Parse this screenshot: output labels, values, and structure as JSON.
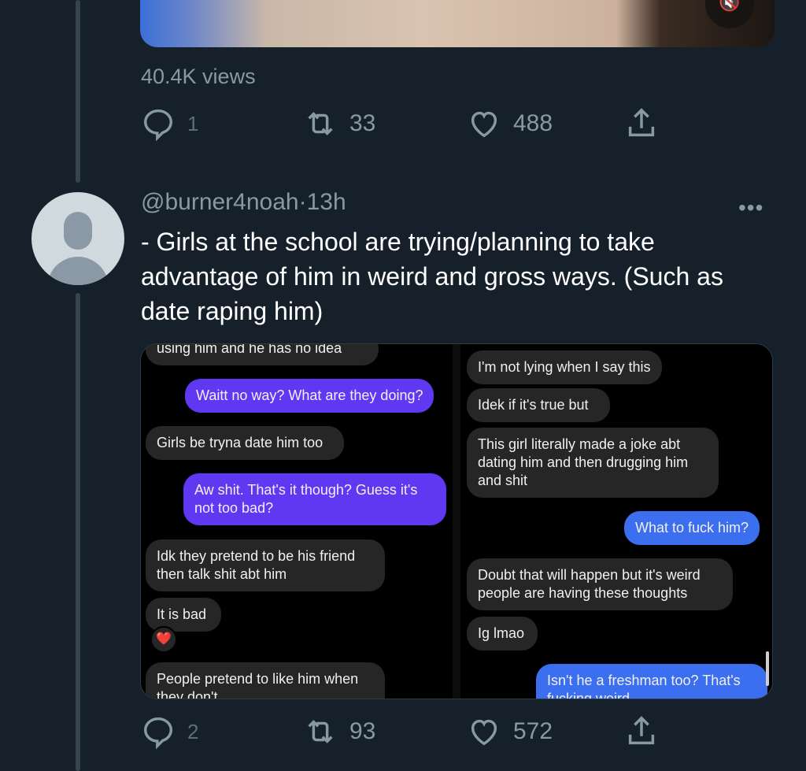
{
  "prev_tweet": {
    "views": "40.4K views",
    "replies": "1",
    "retweets": "33",
    "likes": "488"
  },
  "tweet": {
    "handle": "@burner4noah",
    "separator": "·",
    "time": "13h",
    "more": "•••",
    "text": "- Girls at the school are trying/planning to take advantage of him in weird and gross ways. (Such as date raping him)",
    "replies": "2",
    "retweets": "93",
    "likes": "572"
  },
  "media": {
    "left": {
      "messages": [
        {
          "from": "them",
          "text": "using him and he has no idea"
        },
        {
          "from": "me",
          "text": "Waitt no way? What are they doing?"
        },
        {
          "from": "them",
          "text": "Girls be tryna date him too"
        },
        {
          "from": "me",
          "text": "Aw shit. That's it though? Guess it's\nnot too bad?"
        },
        {
          "from": "them",
          "text": "Idk they pretend to be his friend\nthen talk shit abt him"
        },
        {
          "from": "them",
          "text": "It is bad"
        },
        {
          "from": "them",
          "text": "People pretend to like him when\nthey don't"
        }
      ],
      "reaction": "❤️"
    },
    "right": {
      "messages": [
        {
          "from": "them",
          "text": "I'm not lying when I say this"
        },
        {
          "from": "them",
          "text": "Idek if it's true but"
        },
        {
          "from": "them",
          "text": "This girl literally made a joke abt\ndating him and then drugging him\nand shit"
        },
        {
          "from": "me",
          "text": "What to fuck him?"
        },
        {
          "from": "them",
          "text": "Doubt that will happen but it's weird\npeople are having these thoughts"
        },
        {
          "from": "them",
          "text": "Ig lmao"
        },
        {
          "from": "me",
          "text": "Isn't he a freshman too? That's\nfucking weird"
        }
      ]
    }
  },
  "colors": {
    "background": "#15202b",
    "secondary_text": "#8899a6",
    "incoming_bubble": "#262626",
    "outgoing_bubble_purple": "#6038f2",
    "outgoing_bubble_blue": "#3b6ff0"
  },
  "icons": [
    "reply-icon",
    "retweet-icon",
    "like-icon",
    "share-icon",
    "mute-icon",
    "more-icon"
  ]
}
